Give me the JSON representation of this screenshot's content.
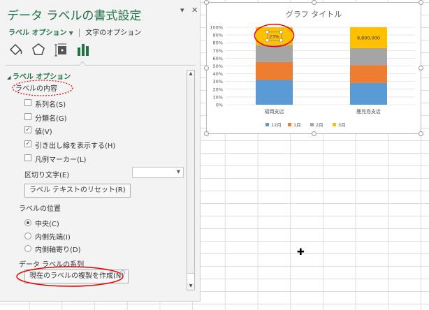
{
  "panel": {
    "title": "データ ラベルの書式設定",
    "menu_icon": "dropdown-triangle-icon",
    "close_icon": "close-icon",
    "tabs": [
      {
        "label": "ラベル オプション",
        "active": true
      },
      {
        "label": "文字のオプション",
        "active": false
      }
    ],
    "icons": [
      "fill-line-icon",
      "effects-pentagon-icon",
      "size-properties-icon",
      "bar-chart-options-icon"
    ],
    "section": "ラベル オプション",
    "content_heading": "ラベルの内容",
    "checkboxes": [
      {
        "label": "系列名(S)",
        "checked": false
      },
      {
        "label": "分類名(G)",
        "checked": false
      },
      {
        "label": "値(V)",
        "checked": true
      },
      {
        "label": "引き出し線を表示する(H)",
        "checked": true
      },
      {
        "label": "凡例マーカー(L)",
        "checked": false
      }
    ],
    "separator_label": "区切り文字(E)",
    "separator_value": "",
    "reset_button": "ラベル テキストのリセット(R)",
    "position_heading": "ラベルの位置",
    "positions": [
      {
        "label": "中央(C)",
        "selected": true
      },
      {
        "label": "内側先端(I)",
        "selected": false
      },
      {
        "label": "内側軸寄り(D)",
        "selected": false
      }
    ],
    "series_heading": "データ ラベルの系列",
    "clone_button": "現在のラベルの複製を作成(N)",
    "accent": "#217346"
  },
  "chart_data": {
    "type": "bar",
    "stacked": "100%",
    "title": "グラフ タイトル",
    "categories": [
      "福岡支店",
      "鹿児島支店"
    ],
    "series": [
      {
        "name": "12月",
        "values": [
          32,
          28
        ],
        "color": "#5b9bd5"
      },
      {
        "name": "1月",
        "values": [
          23,
          23
        ],
        "color": "#ed7d31"
      },
      {
        "name": "2月",
        "values": [
          22,
          22
        ],
        "color": "#a5a5a5"
      },
      {
        "name": "3月",
        "values": [
          23,
          27
        ],
        "color": "#ffc000"
      }
    ],
    "data_labels": [
      "23%",
      "8,800,000"
    ],
    "yticks": [
      "0%",
      "10%",
      "20%",
      "30%",
      "40%",
      "50%",
      "60%",
      "70%",
      "80%",
      "90%",
      "100%"
    ],
    "ylim": [
      0,
      100
    ],
    "grid": true,
    "legend": "bottom"
  }
}
